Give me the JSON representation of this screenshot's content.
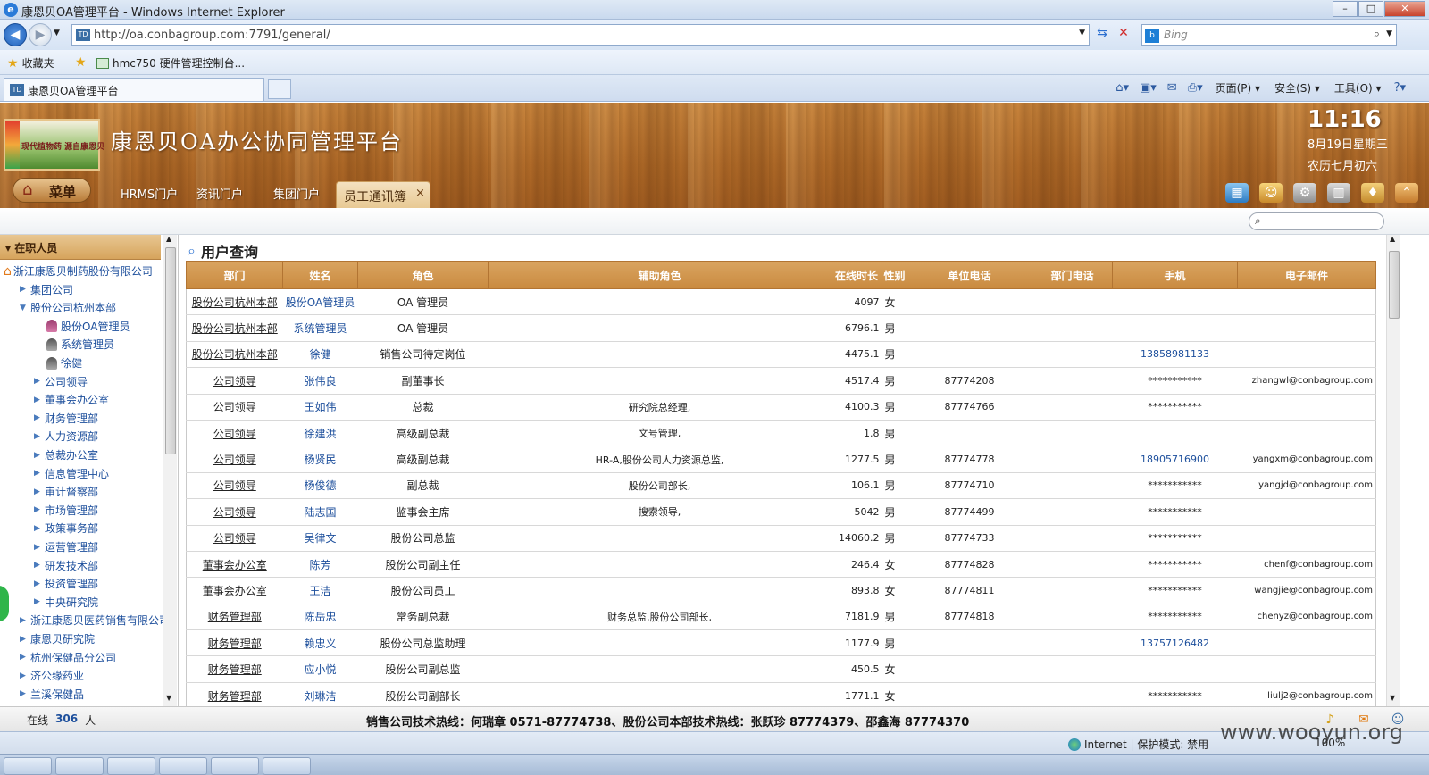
{
  "browser": {
    "window_title": "康恩贝OA管理平台 - Windows Internet Explorer",
    "url": "http://oa.conbagroup.com:7791/general/",
    "search_placeholder": "Bing",
    "favorites_label": "收藏夹",
    "favorite_link": "hmc750 硬件管理控制台...",
    "tab_label": "康恩贝OA管理平台",
    "cmd_menus": [
      "页面(P)",
      "安全(S)",
      "工具(O)"
    ],
    "status_zone": "Internet | 保护模式: 禁用",
    "status_zoom": "100%",
    "watermark": "www.wooyun.org"
  },
  "header": {
    "logo_text": "现代植物药 源自康恩贝",
    "app_title": "康恩贝OA办公协同管理平台",
    "clock": "11:16",
    "date": "8月19日星期三",
    "lunar": "农历七月初六",
    "menu_label": "菜单",
    "tabs": [
      "HRMS门户",
      "资讯门户",
      "集团门户"
    ],
    "active_tab": "员工通讯簿",
    "close_glyph": "×"
  },
  "sidebar": {
    "title": "在职人员",
    "items": [
      {
        "label": "浙江康恩贝制药股份有限公司",
        "level": 0,
        "type": "root"
      },
      {
        "label": "集团公司",
        "level": 1,
        "type": "collapsed"
      },
      {
        "label": "股份公司杭州本部",
        "level": 1,
        "type": "expanded"
      },
      {
        "label": "股份OA管理员",
        "level": 3,
        "type": "user-female"
      },
      {
        "label": "系统管理员",
        "level": 3,
        "type": "user"
      },
      {
        "label": "徐健",
        "level": 3,
        "type": "user"
      },
      {
        "label": "公司领导",
        "level": 2,
        "type": "collapsed"
      },
      {
        "label": "董事会办公室",
        "level": 2,
        "type": "collapsed"
      },
      {
        "label": "财务管理部",
        "level": 2,
        "type": "collapsed"
      },
      {
        "label": "人力资源部",
        "level": 2,
        "type": "collapsed"
      },
      {
        "label": "总裁办公室",
        "level": 2,
        "type": "collapsed"
      },
      {
        "label": "信息管理中心",
        "level": 2,
        "type": "collapsed"
      },
      {
        "label": "审计督察部",
        "level": 2,
        "type": "collapsed"
      },
      {
        "label": "市场管理部",
        "level": 2,
        "type": "collapsed"
      },
      {
        "label": "政策事务部",
        "level": 2,
        "type": "collapsed"
      },
      {
        "label": "运营管理部",
        "level": 2,
        "type": "collapsed"
      },
      {
        "label": "研发技术部",
        "level": 2,
        "type": "collapsed"
      },
      {
        "label": "投资管理部",
        "level": 2,
        "type": "collapsed"
      },
      {
        "label": "中央研究院",
        "level": 2,
        "type": "collapsed"
      },
      {
        "label": "浙江康恩贝医药销售有限公司",
        "level": 1,
        "type": "collapsed"
      },
      {
        "label": "康恩贝研究院",
        "level": 1,
        "type": "collapsed"
      },
      {
        "label": "杭州保健品分公司",
        "level": 1,
        "type": "collapsed"
      },
      {
        "label": "济公缘药业",
        "level": 1,
        "type": "collapsed"
      },
      {
        "label": "兰溪保健品",
        "level": 1,
        "type": "collapsed"
      }
    ]
  },
  "main": {
    "heading": "用户查询",
    "columns": [
      "部门",
      "姓名",
      "角色",
      "辅助角色",
      "在线时长",
      "性别",
      "单位电话",
      "部门电话",
      "手机",
      "电子邮件"
    ],
    "rows": [
      [
        "股份公司杭州本部",
        "股份OA管理员",
        "OA 管理员",
        "",
        "4097",
        "女",
        "",
        "",
        "",
        ""
      ],
      [
        "股份公司杭州本部",
        "系统管理员",
        "OA 管理员",
        "",
        "6796.1",
        "男",
        "",
        "",
        "",
        ""
      ],
      [
        "股份公司杭州本部",
        "徐健",
        "销售公司待定岗位",
        "",
        "4475.1",
        "男",
        "",
        "",
        "13858981133",
        ""
      ],
      [
        "公司领导",
        "张伟良",
        "副董事长",
        "",
        "4517.4",
        "男",
        "87774208",
        "",
        "***********",
        "zhangwl@conbagroup.com"
      ],
      [
        "公司领导",
        "王如伟",
        "总裁",
        "研究院总经理,",
        "4100.3",
        "男",
        "87774766",
        "",
        "***********",
        ""
      ],
      [
        "公司领导",
        "徐建洪",
        "高级副总裁",
        "文号管理,",
        "1.8",
        "男",
        "",
        "",
        "",
        ""
      ],
      [
        "公司领导",
        "杨贤民",
        "高级副总裁",
        "HR-A,股份公司人力资源总监,",
        "1277.5",
        "男",
        "87774778",
        "",
        "18905716900",
        "yangxm@conbagroup.com"
      ],
      [
        "公司领导",
        "杨俊德",
        "副总裁",
        "股份公司部长,",
        "106.1",
        "男",
        "87774710",
        "",
        "***********",
        "yangjd@conbagroup.com"
      ],
      [
        "公司领导",
        "陆志国",
        "监事会主席",
        "搜索领导,",
        "5042",
        "男",
        "87774499",
        "",
        "***********",
        ""
      ],
      [
        "公司领导",
        "吴律文",
        "股份公司总监",
        "",
        "14060.2",
        "男",
        "87774733",
        "",
        "***********",
        ""
      ],
      [
        "董事会办公室",
        "陈芳",
        "股份公司副主任",
        "",
        "246.4",
        "女",
        "87774828",
        "",
        "***********",
        "chenf@conbagroup.com"
      ],
      [
        "董事会办公室",
        "王洁",
        "股份公司员工",
        "",
        "893.8",
        "女",
        "87774811",
        "",
        "***********",
        "wangjie@conbagroup.com"
      ],
      [
        "财务管理部",
        "陈岳忠",
        "常务副总裁",
        "财务总监,股份公司部长,",
        "7181.9",
        "男",
        "87774818",
        "",
        "***********",
        "chenyz@conbagroup.com"
      ],
      [
        "财务管理部",
        "赖忠义",
        "股份公司总监助理",
        "",
        "1177.9",
        "男",
        "",
        "",
        "13757126482",
        ""
      ],
      [
        "财务管理部",
        "应小悦",
        "股份公司副总监",
        "",
        "450.5",
        "女",
        "",
        "",
        "",
        ""
      ],
      [
        "财务管理部",
        "刘琳洁",
        "股份公司副部长",
        "",
        "1771.1",
        "女",
        "",
        "",
        "***********",
        "liulj2@conbagroup.com"
      ]
    ]
  },
  "status": {
    "online_label": "在线",
    "online_count": "306",
    "online_unit": "人",
    "hotline": "销售公司技术热线：何瑞章 0571-87774738、股份公司本部技术热线：张跃珍 87774379、邵鑫海 87774370"
  },
  "colors": {
    "accent": "#d6a45c",
    "link": "#1d4f9c"
  }
}
